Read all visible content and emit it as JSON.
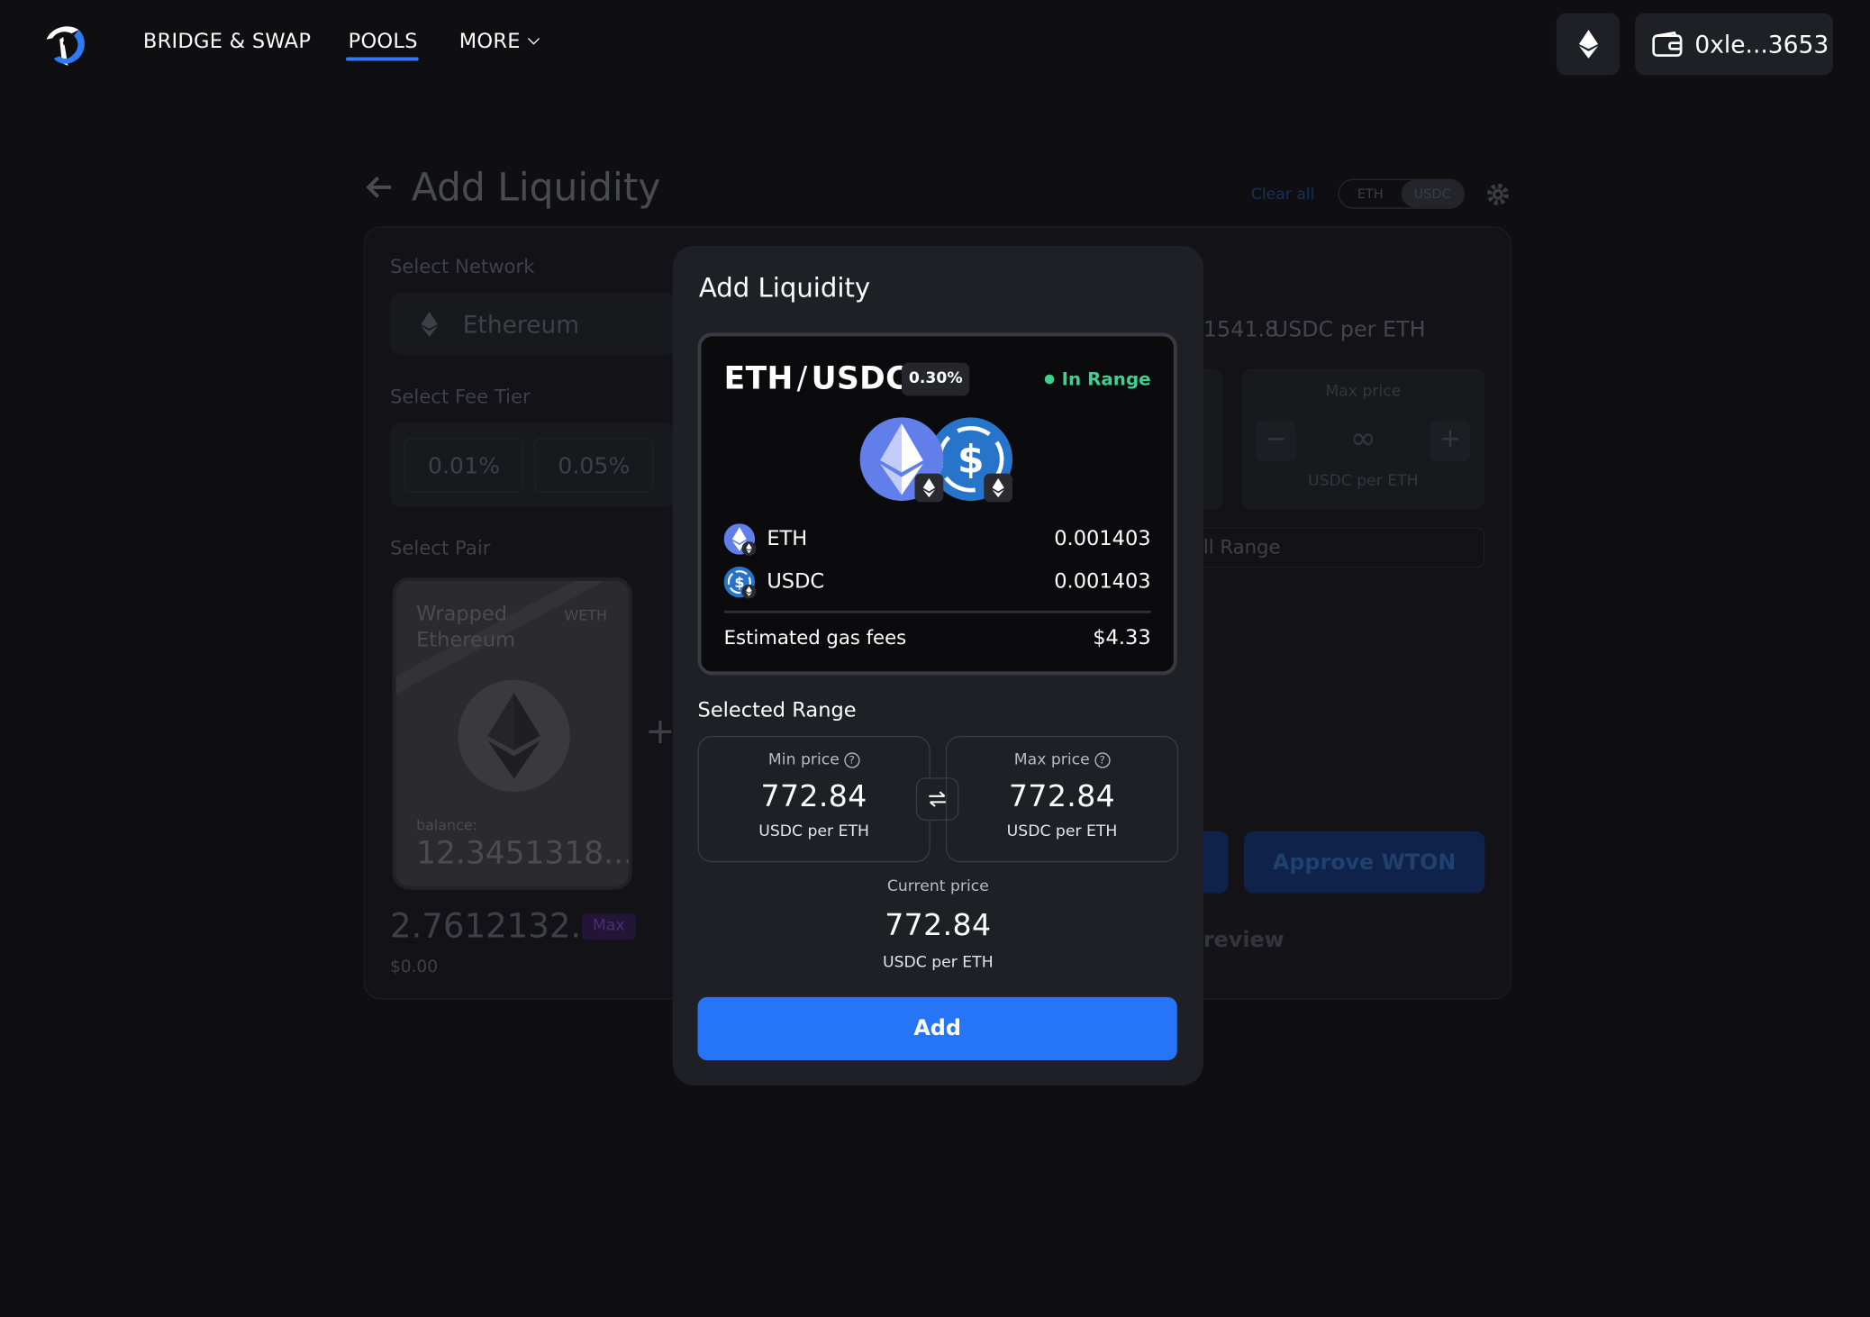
{
  "header": {
    "nav": [
      "BRIDGE & SWAP",
      "POOLS",
      "MORE"
    ],
    "active_nav": "POOLS",
    "network_icon": "ethereum-icon",
    "wallet_address": "0xle...3653",
    "wallet_icon": "wallet-icon"
  },
  "background": {
    "title": "Add Liquidity",
    "clear_all": "Clear all",
    "toggle": [
      "ETH",
      "USDC"
    ],
    "select_network_label": "Select Network",
    "network": "Ethereum",
    "select_fee_tier_label": "Select Fee Tier",
    "fee_tiers": [
      "0.01%",
      "0.05%"
    ],
    "select_pair_label": "Select Pair",
    "token_card": {
      "name": "Wrapped Ethereum",
      "symbol": "WETH",
      "balance_label": "balance:",
      "balance": "12.3451318..."
    },
    "amount": "2.7612132...",
    "max_label": "Max",
    "usd_value": "$0.00",
    "current_price_partial": "1541.8",
    "price_unit_partial": "USDC per ETH",
    "max_price_label": "Max price",
    "max_price_value": "∞",
    "max_price_unit": "USDC per ETH",
    "full_range_partial": "ll Range",
    "approve_label": "Approve WTON",
    "preview_partial": "review"
  },
  "modal": {
    "title": "Add Liquidity",
    "pair": {
      "base": "ETH",
      "quote": "USDC",
      "separator": "/"
    },
    "fee": "0.30%",
    "status": "In Range",
    "tokens": [
      {
        "symbol": "ETH",
        "amount": "0.001403"
      },
      {
        "symbol": "USDC",
        "amount": "0.001403"
      }
    ],
    "gas_label": "Estimated gas fees",
    "gas_value": "$4.33",
    "selected_range_label": "Selected Range",
    "min": {
      "label": "Min price",
      "value": "772.84",
      "unit": "USDC per ETH"
    },
    "max": {
      "label": "Max price",
      "value": "772.84",
      "unit": "USDC per ETH"
    },
    "current": {
      "label": "Current price",
      "value": "772.84",
      "unit": "USDC per ETH"
    },
    "add_button": "Add"
  },
  "colors": {
    "accent": "#2775f7",
    "in_range": "#3fcf8e",
    "background": "#0f0f12",
    "modal": "#1f2026"
  }
}
